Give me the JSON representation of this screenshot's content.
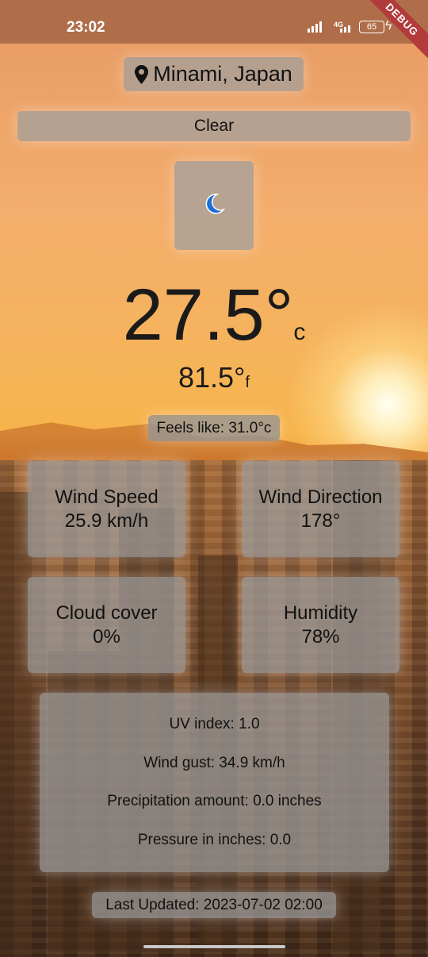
{
  "status": {
    "time": "23:02",
    "network": "4G",
    "battery": "65"
  },
  "debug_banner": "DEBUG",
  "location": {
    "name": "Minami, Japan"
  },
  "condition": {
    "text": "Clear"
  },
  "weather_icon": "crescent-moon-icon",
  "temperature": {
    "celsius": "27.5°",
    "celsius_unit": "c",
    "fahrenheit": "81.5°",
    "fahrenheit_unit": "f"
  },
  "feels_like": "Feels like: 31.0°c",
  "cards": {
    "wind_speed": {
      "label": "Wind Speed",
      "value": "25.9 km/h"
    },
    "wind_direction": {
      "label": "Wind Direction",
      "value": "178°"
    },
    "cloud_cover": {
      "label": "Cloud cover",
      "value": "0%"
    },
    "humidity": {
      "label": "Humidity",
      "value": "78%"
    }
  },
  "details": {
    "uv": "UV index: 1.0",
    "gust": "Wind gust: 34.9 km/h",
    "precip": "Precipitation amount: 0.0 inches",
    "pressure": "Pressure in inches: 0.0"
  },
  "last_updated": "Last Updated: 2023-07-02 02:00",
  "colors": {
    "accent_icon": "#1e6fd6",
    "panel": "#a0a0a0"
  }
}
